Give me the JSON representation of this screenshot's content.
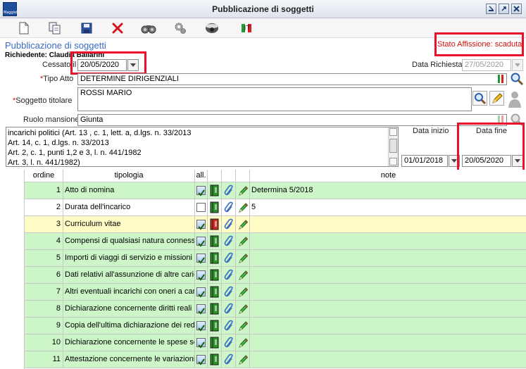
{
  "window": {
    "title": "Pubblicazione di soggetti",
    "app_logo_text": "Maggioli",
    "controls": [
      "minimize",
      "maximize",
      "close"
    ]
  },
  "toolbar": {
    "buttons": [
      {
        "name": "new",
        "icon": "new-document-icon"
      },
      {
        "name": "copy",
        "icon": "copy-icon"
      },
      {
        "name": "save",
        "icon": "save-icon"
      },
      {
        "name": "delete",
        "icon": "delete-icon"
      },
      {
        "name": "search",
        "icon": "binoculars-icon"
      },
      {
        "name": "config",
        "icon": "gears-icon"
      },
      {
        "name": "camera",
        "icon": "camera-icon"
      }
    ],
    "lang_label": "IT"
  },
  "header": {
    "page_title": "Pubblicazione di soggetti",
    "requester": "Richiedente: Claudia Ballarini",
    "status": "Stato Affissione: scaduta"
  },
  "form": {
    "cessato_label": "Cessato il",
    "cessato_value": "20/05/2020",
    "data_richiesta_label": "Data Richiesta",
    "data_richiesta_value": "27/05/2020",
    "tipo_atto_label": "Tipo Atto",
    "tipo_atto_value": "DETERMINE DIRIGENZIALI",
    "soggetto_label": "Soggetto titolare",
    "soggetto_value": "ROSSI MARIO",
    "ruolo_label": "Ruolo mansione",
    "ruolo_value": "Giunta",
    "required_mark": "*",
    "riferimenti": [
      "incarichi politici (Art. 13 , c. 1, lett. a, d.lgs. n. 33/2013",
      "Art. 14, c. 1, d.lgs. n. 33/2013",
      "Art. 2, c. 1, punti 1,2 e 3, l. n. 441/1982",
      "Art. 3, l. n. 441/1982)"
    ],
    "data_inizio_label": "Data inizio",
    "data_inizio_value": "01/01/2018",
    "data_fine_label": "Data fine",
    "data_fine_value": "20/05/2020"
  },
  "grid": {
    "columns": {
      "ordine": "ordine",
      "tipologia": "tipologia",
      "all": "all.",
      "note": "note"
    },
    "rows": [
      {
        "ordine": "1",
        "tipologia": "Atto di nomina",
        "checked": true,
        "note": "Determina 5/2018",
        "color": "green"
      },
      {
        "ordine": "2",
        "tipologia": "Durata dell'incarico",
        "checked": false,
        "note": "5",
        "color": "white"
      },
      {
        "ordine": "3",
        "tipologia": "Curriculum vitae",
        "checked": true,
        "note": "",
        "color": "yellow"
      },
      {
        "ordine": "4",
        "tipologia": "Compensi di qualsiasi natura connessi a",
        "checked": true,
        "note": "",
        "color": "green"
      },
      {
        "ordine": "5",
        "tipologia": "Importi di viaggi di servizio e missioni p",
        "checked": true,
        "note": "",
        "color": "green"
      },
      {
        "ordine": "6",
        "tipologia": "Dati relativi all'assunzione di altre caric",
        "checked": true,
        "note": "",
        "color": "green"
      },
      {
        "ordine": "7",
        "tipologia": "Altri eventuali incarichi con oneri a cari",
        "checked": true,
        "note": "",
        "color": "green"
      },
      {
        "ordine": "8",
        "tipologia": "Dichiarazione concernente diritti reali s",
        "checked": true,
        "note": "",
        "color": "green"
      },
      {
        "ordine": "9",
        "tipologia": "Copia dell'ultima dichiarazione dei redd",
        "checked": true,
        "note": "",
        "color": "green"
      },
      {
        "ordine": "10",
        "tipologia": "Dichiarazione concernente le spese so",
        "checked": true,
        "note": "",
        "color": "green"
      },
      {
        "ordine": "11",
        "tipologia": "Attestazione concernente le variazioni",
        "checked": true,
        "note": "",
        "color": "green"
      }
    ]
  },
  "colors": {
    "row_green": "#ccf5c8",
    "row_yellow": "#fffcc6",
    "highlight": "#e8102a",
    "title_blue": "#3a6bc6"
  }
}
